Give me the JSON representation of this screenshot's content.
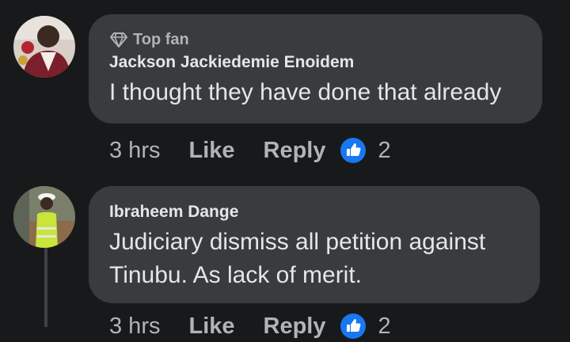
{
  "comments": [
    {
      "badge": "Top fan",
      "author": "Jackson Jackiedemie Enoidem",
      "text": "I thought they have done that already",
      "time": "3 hrs",
      "like_label": "Like",
      "reply_label": "Reply",
      "reaction_count": "2"
    },
    {
      "author": "Ibraheem Dange",
      "text": "Judiciary dismiss all petition against Tinubu. As lack of merit.",
      "time": "3 hrs",
      "like_label": "Like",
      "reply_label": "Reply",
      "reaction_count": "2"
    }
  ],
  "colors": {
    "background": "#18191a",
    "bubble": "#3a3b3c",
    "primary_text": "#e4e6eb",
    "secondary_text": "#b0b3b8",
    "like_blue": "#1877f2"
  },
  "icons": {
    "badge": "diamond-icon",
    "reaction": "thumbs-up-icon"
  }
}
